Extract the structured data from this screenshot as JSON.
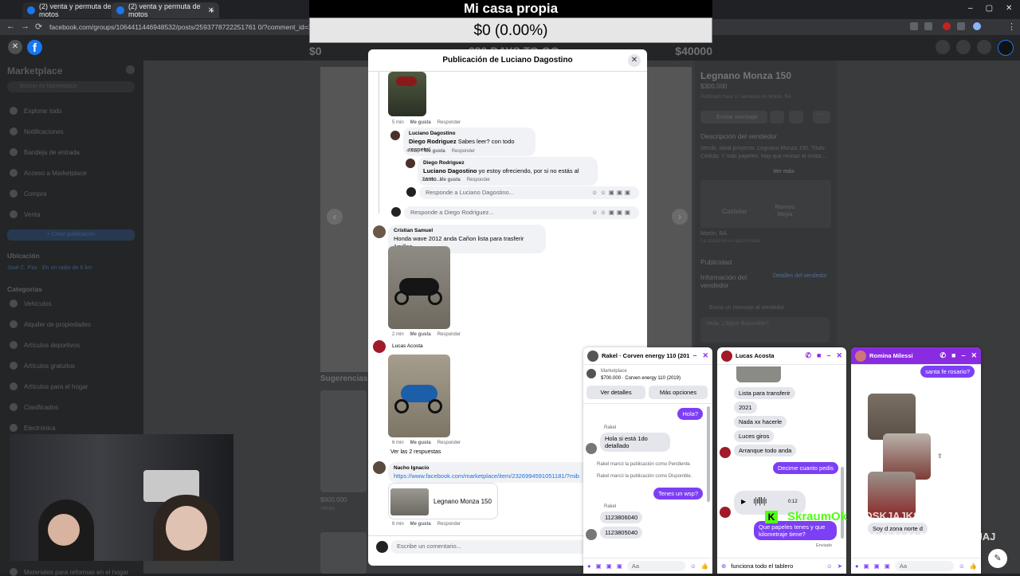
{
  "browser": {
    "tabs": [
      {
        "title": "(2) venta y permuta de motos",
        "active": false
      },
      {
        "title": "(2) venta y permuta de motos",
        "active": true
      }
    ],
    "url": "facebook.com/groups/1064411446948532/posts/2593778722251761 0/?comment_id=25937802399"
  },
  "overlay": {
    "title": "Mi casa propia",
    "amount": "$0 (0.00%)",
    "range_min": "$0",
    "range_mid": "230 DAYS TO GO",
    "range_max": "$40000"
  },
  "sidebar": {
    "title": "Marketplace",
    "search_placeholder": "Buscar en Marketplace",
    "items": [
      "Explorar todo",
      "Notificaciones",
      "Bandeja de entrada",
      "Acceso a Marketplace",
      "Compra",
      "Venta"
    ],
    "create_button": "+ Crear publicación",
    "location_heading": "Ubicación",
    "location_value": "José C. Paz · En un radio de 6 km",
    "categories_heading": "Categorías",
    "categories": [
      "Vehículos",
      "Alquiler de propiedades",
      "Artículos deportivos",
      "Artículos gratuitos",
      "Artículos para el hogar",
      "Clasificados",
      "Electrónica"
    ],
    "footer_item": "Materiales para reformas en el hogar"
  },
  "main": {
    "suggestions_heading": "Sugerencias d",
    "card_price": "$800.000",
    "card_subtitle": "Venta"
  },
  "listing": {
    "title": "Legnano Monza 150",
    "price": "$300.000",
    "posted": "Publicado hace 17 semanas en Morón, BA",
    "send_button": "Enviar mensaje",
    "desc_heading": "Descripción del vendedor",
    "desc": "Vendo, ideal proyecto. Legnano Monza 150. Titulo. Cédula. Y más papeles. Hay que revisar el motor....",
    "see_more": "Ver más",
    "map_label_1": "Castelar",
    "map_label_2": "Ramos Mejía",
    "location": "Morón, BA",
    "location_note": "La ubicación es aproximada",
    "public_heading": "Publicidad",
    "seller_heading": "Información del vendedor",
    "seller_link": "Detalles del vendedor",
    "message_prompt": "Envía un mensaje al vendedor",
    "message_placeholder": "Hola. ¿Sigue disponible?"
  },
  "modal": {
    "title": "Publicación de Luciano Dagostino",
    "meta_like": "Me gusta",
    "meta_reply": "Responder",
    "comments": [
      {
        "time": "5 min"
      },
      {
        "author": "Luciano Dagostino",
        "mention": "Diego Rodriguez",
        "text": "Sabes leer? con todo respeto!",
        "time": "4 min"
      },
      {
        "author": "Diego Rodriguez",
        "mention": "Luciano Dagostino",
        "text": "yo estoy ofreciendo, por si no estás al tanto...",
        "time": "2 min"
      },
      {
        "reply_placeholder": "Responde a Luciano Dagostino..."
      },
      {
        "reply_placeholder": "Responde a Diego Rodriguez..."
      },
      {
        "author": "Cristian Samuel",
        "text": "Honda wave 2012 anda Cañon lista para trasferir 1millon",
        "time": "2 min"
      },
      {
        "author": "Lucas Acosta",
        "time": "6 min",
        "see_replies": "Ver las 2 respuestas"
      },
      {
        "author": "Nacho Ignacio",
        "link": "https://www.facebook.com/marketplace/item/2326994591051181/?mib",
        "card_title": "Legnano Monza 150",
        "time": "6 min"
      }
    ],
    "write_comment": "Escribe un comentario..."
  },
  "chat1": {
    "title": "Rakel · Corven energy 110 (2019)",
    "mp_label": "Marketplace",
    "mp_item": "$700.000 · Corven energy 110 (2019)",
    "btn_details": "Ver detalles",
    "btn_more": "Más opciones",
    "m1": "Hola?",
    "sender": "Rakel",
    "m2": "Hola si está 1do detallado",
    "sys1": "Rakel marcó la publicación como Pendiente.",
    "sys2": "Rakel marcó la publicación como Disponible.",
    "m3": "Tenes un wsp?",
    "m4": "1123806040",
    "m5": "1123805040",
    "input_placeholder": "Aa"
  },
  "chat2": {
    "title": "Lucas Acosta",
    "msgs": [
      "Lista para transferir",
      "2021",
      "Nada xx hacerle",
      "Luces giros",
      "Arranque todo anda"
    ],
    "out1": "Decime cuanto pedis",
    "audio_time": "0:12",
    "out2": "Que papeles tenes y que kilometraje tiene?",
    "status": "Enviado",
    "input_value": "funciona todo el tablero"
  },
  "chat3": {
    "title": "Romina Milessi",
    "out1": "santa fe rosario?",
    "in1": "Soy d zona norte d",
    "input_placeholder": "Aa"
  },
  "stream": {
    "badge": "K",
    "username": "SkraumOk",
    "chat_line_1": "ADSKJAJKSAJJAJAJAJ",
    "chat_line_2": "AJAJAJAJAJAJJAJAJAJAJ"
  },
  "colors": {
    "accent": "#7d3ff5",
    "facebook_blue": "#1877f2",
    "kick_green": "#53fc18"
  }
}
